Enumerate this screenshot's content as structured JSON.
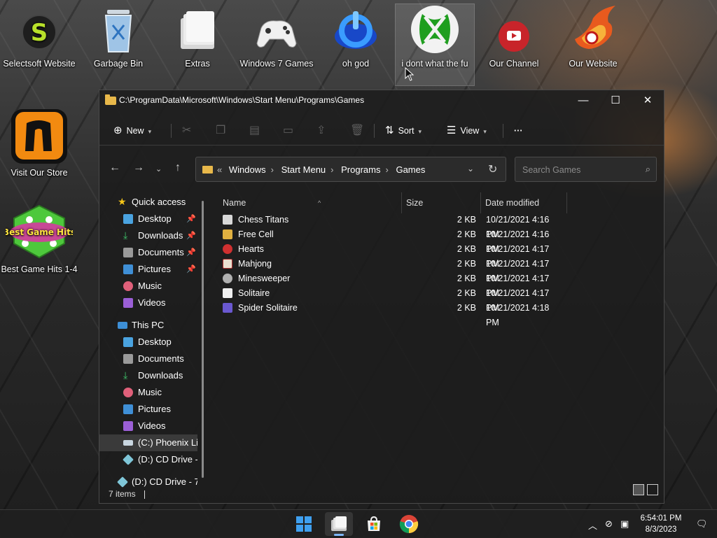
{
  "desktop": {
    "icons": [
      {
        "label": "Selectsoft Website"
      },
      {
        "label": "Garbage Bin"
      },
      {
        "label": "Extras"
      },
      {
        "label": "Windows 7 Games"
      },
      {
        "label": "oh god"
      },
      {
        "label": "i dont what the fu"
      },
      {
        "label": "Our Channel"
      },
      {
        "label": "Our Website"
      },
      {
        "label": "Visit Our Store"
      },
      {
        "label": "Best Game Hits 1-4"
      }
    ],
    "best_game_hits_art_text": "Best Game Hits"
  },
  "window": {
    "title_path": "C:\\ProgramData\\Microsoft\\Windows\\Start Menu\\Programs\\Games",
    "minimize_glyph": "—",
    "maximize_glyph": "☐",
    "close_glyph": "✕"
  },
  "commandbar": {
    "new_label": "New",
    "sort_label": "Sort",
    "view_label": "View",
    "more_label": "···"
  },
  "address": {
    "overflow": "«",
    "crumbs": [
      "Windows",
      "Start Menu",
      "Programs",
      "Games"
    ]
  },
  "search": {
    "placeholder": "Search Games"
  },
  "sidebar": {
    "quick_access": "Quick access",
    "quick_items": [
      "Desktop",
      "Downloads",
      "Documents",
      "Pictures",
      "Music",
      "Videos"
    ],
    "this_pc": "This PC",
    "pc_items": [
      "Desktop",
      "Documents",
      "Downloads",
      "Music",
      "Pictures",
      "Videos",
      "(C:) Phoenix Lit",
      "(D:) CD Drive -"
    ],
    "bottom_item": "(D:) CD Drive - 7"
  },
  "columns": {
    "name": "Name",
    "size": "Size",
    "date": "Date modified"
  },
  "files": [
    {
      "name": "Chess Titans",
      "size": "2 KB",
      "date": "10/21/2021 4:16 PM"
    },
    {
      "name": "Free Cell",
      "size": "2 KB",
      "date": "10/21/2021 4:16 PM"
    },
    {
      "name": "Hearts",
      "size": "2 KB",
      "date": "10/21/2021 4:17 PM"
    },
    {
      "name": "Mahjong",
      "size": "2 KB",
      "date": "10/21/2021 4:17 PM"
    },
    {
      "name": "Minesweeper",
      "size": "2 KB",
      "date": "10/21/2021 4:17 PM"
    },
    {
      "name": "Solitaire",
      "size": "2 KB",
      "date": "10/21/2021 4:17 PM"
    },
    {
      "name": "Spider Solitaire",
      "size": "2 KB",
      "date": "10/21/2021 4:18 PM"
    }
  ],
  "status": {
    "items": "7 items"
  },
  "taskbar": {
    "time": "6:54:01 PM",
    "date": "8/3/2023"
  },
  "colors": {
    "accent": "#7fb8ff",
    "folder": "#e8b84a"
  }
}
